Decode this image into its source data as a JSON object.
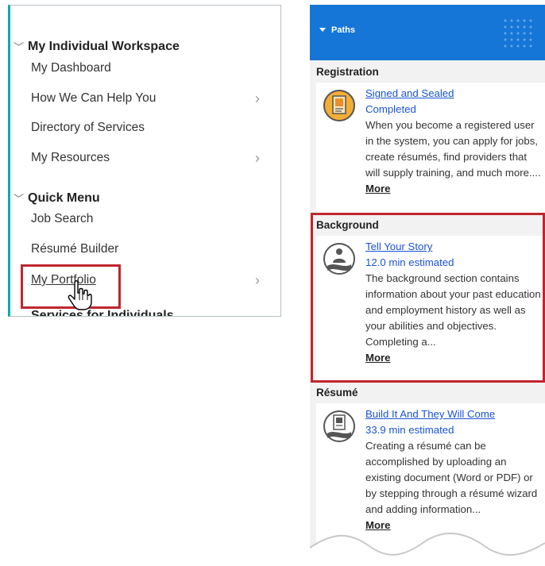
{
  "menu": {
    "sections": [
      {
        "heading": "My Individual Workspace",
        "items": [
          "My Dashboard",
          "How We Can Help You",
          "Directory of Services",
          "My Resources"
        ]
      },
      {
        "heading": "Quick Menu",
        "items": [
          "Job Search",
          "Résumé Builder",
          "My Portfolio"
        ]
      }
    ],
    "cut_off_label": "Services for Individuals"
  },
  "paths": {
    "header_title": "Paths",
    "header_color": "#1576d8",
    "categories": [
      {
        "name": "Registration",
        "card": {
          "title": "Signed and Sealed",
          "status": "Completed",
          "description": "When you become a registered user in the system, you can apply for jobs, create résumés, find providers that will supply training, and much more....",
          "more": "More",
          "icon": "certificate-icon"
        }
      },
      {
        "name": "Background",
        "card": {
          "title": "Tell Your Story",
          "status": "12.0 min estimated",
          "description": "The background section contains information about your past education and employment history as well as your abilities and objectives. Completing a...",
          "more": "More",
          "icon": "person-story-icon"
        }
      },
      {
        "name": "Résumé",
        "card": {
          "title": "Build It And They Will Come",
          "status": "33.9 min estimated",
          "description": "Creating a résumé can be accomplished by uploading an existing document (Word or PDF) or by stepping through a résumé wizard and adding information...",
          "more": "More",
          "icon": "resume-document-icon"
        }
      }
    ]
  },
  "colors": {
    "highlight": "#c0262d",
    "link": "#1a53d6",
    "menu_accent": "#00afaa"
  }
}
